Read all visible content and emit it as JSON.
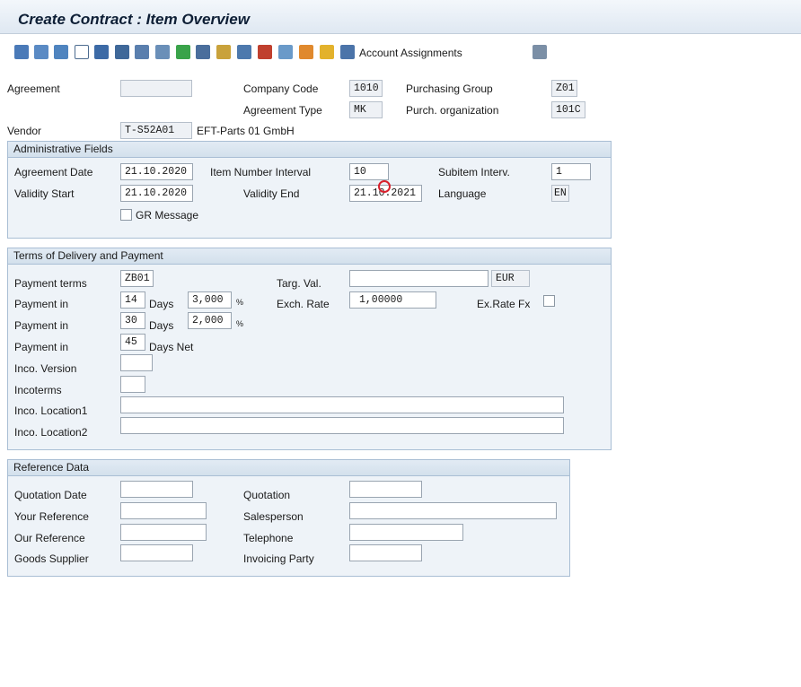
{
  "title": "Create Contract : Item Overview",
  "toolbar": {
    "account_assignments_label": "Account Assignments",
    "icons": [
      "prev-item-icon",
      "next-item-icon",
      "item-detail-icon",
      "new-doc-icon",
      "delete-icon",
      "print-icon",
      "texts-icon",
      "partners-icon",
      "flag-icon",
      "print-preview-icon",
      "conditions-icon",
      "find-icon",
      "stats-icon",
      "edit-icon",
      "services-icon",
      "chart-icon",
      "list-icon",
      "settings-icon"
    ]
  },
  "header": {
    "agreement_label": "Agreement",
    "agreement_value": "",
    "company_code_label": "Company Code",
    "company_code_value": "1010",
    "purchasing_group_label": "Purchasing Group",
    "purchasing_group_value": "Z01",
    "agreement_type_label": "Agreement Type",
    "agreement_type_value": "MK",
    "purch_org_label": "Purch. organization",
    "purch_org_value": "101C",
    "vendor_label": "Vendor",
    "vendor_value": "T-S52A01",
    "vendor_name": "EFT-Parts 01 GmbH"
  },
  "admin": {
    "title": "Administrative Fields",
    "agreement_date_label": "Agreement Date",
    "agreement_date_value": "21.10.2020",
    "item_interval_label": "Item Number Interval",
    "item_interval_value": "10",
    "subitem_interval_label": "Subitem Interv.",
    "subitem_interval_value": "1",
    "validity_start_label": "Validity Start",
    "validity_start_value": "21.10.2020",
    "validity_end_label": "Validity End",
    "validity_end_value": "21.10.2021",
    "language_label": "Language",
    "language_value": "EN",
    "gr_message_label": "GR Message"
  },
  "terms": {
    "title": "Terms of Delivery and Payment",
    "payment_terms_label": "Payment terms",
    "payment_terms_value": "ZB01",
    "targ_val_label": "Targ. Val.",
    "targ_val_value": "",
    "currency_value": "EUR",
    "payment_in_label": "Payment in",
    "days_label": "Days",
    "days_net_label": "Days Net",
    "pct_sign": "%",
    "pay1_days": "14",
    "pay1_pct": "3,000",
    "pay2_days": "30",
    "pay2_pct": "2,000",
    "pay3_days": "45",
    "exch_rate_label": "Exch. Rate",
    "exch_rate_value": "1,00000",
    "ex_rate_fx_label": "Ex.Rate Fx",
    "inco_version_label": "Inco. Version",
    "incoterms_label": "Incoterms",
    "inco_location1_label": "Inco. Location1",
    "inco_location2_label": "Inco. Location2"
  },
  "reference": {
    "title": "Reference Data",
    "quotation_date_label": "Quotation Date",
    "quotation_label": "Quotation",
    "your_reference_label": "Your Reference",
    "salesperson_label": "Salesperson",
    "our_reference_label": "Our Reference",
    "telephone_label": "Telephone",
    "goods_supplier_label": "Goods Supplier",
    "invoicing_party_label": "Invoicing Party"
  }
}
